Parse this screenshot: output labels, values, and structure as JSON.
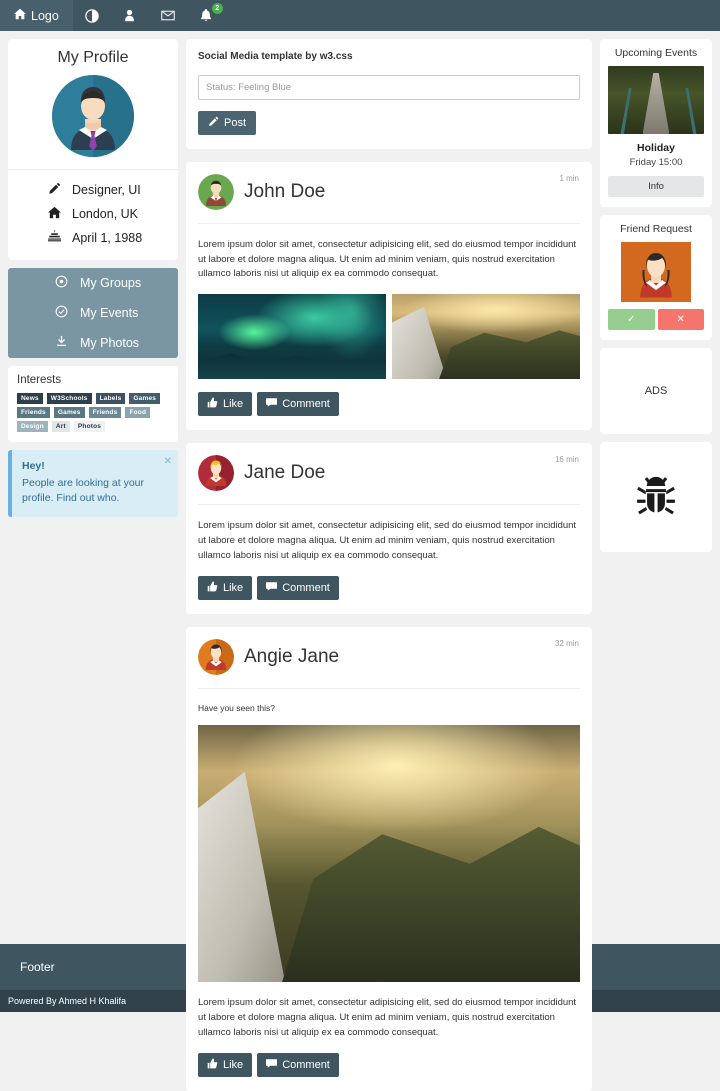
{
  "topbar": {
    "logo_label": "Logo",
    "logo_icon": "home-icon",
    "icons": [
      {
        "name": "globe-icon",
        "glyph": "◔"
      },
      {
        "name": "user-icon",
        "glyph": "♟"
      },
      {
        "name": "envelope-icon",
        "glyph": "✉"
      },
      {
        "name": "bell-icon",
        "glyph": "ὑ4",
        "badge": "2"
      }
    ],
    "badge_count": "2",
    "bg_color": "#3f5661",
    "badge_color": "#4CAF50"
  },
  "profile": {
    "title": "My Profile",
    "avatar": "male-avatar",
    "meta": [
      {
        "icon": "pencil-icon",
        "label": "Designer, UI"
      },
      {
        "icon": "home-icon",
        "label": "London, UK"
      },
      {
        "icon": "birthday-cake-icon",
        "label": "April 1, 1988"
      }
    ]
  },
  "menu": {
    "bg_color": "#7b96a3",
    "items": [
      {
        "icon": "bullseye-icon",
        "label": "My Groups"
      },
      {
        "icon": "check-circle-icon",
        "label": "My Events"
      },
      {
        "icon": "download-icon",
        "label": "My Photos"
      }
    ]
  },
  "interests": {
    "title": "Interests",
    "tags": [
      {
        "label": "News",
        "shade": "#2e3f4a"
      },
      {
        "label": "W3Schools",
        "shade": "#2e3f4a"
      },
      {
        "label": "Labels",
        "shade": "#3c5260"
      },
      {
        "label": "Games",
        "shade": "#445d6b"
      },
      {
        "label": "Friends",
        "shade": "#5a7784"
      },
      {
        "label": "Games",
        "shade": "#5a7784"
      },
      {
        "label": "Friends",
        "shade": "#6c8896"
      },
      {
        "label": "Food",
        "shade": "#8aa3af"
      },
      {
        "label": "Design",
        "shade": "#9db3bd"
      },
      {
        "label": "Art",
        "shade": "#dfe6ea",
        "text": "#333"
      },
      {
        "label": "Photos",
        "shade": "#eef2f4",
        "text": "#333"
      }
    ]
  },
  "alert": {
    "title": "Hey!",
    "text": "People are looking at your profile. Find out who.",
    "close_icon": "close-icon",
    "bg_color": "#d9edf7"
  },
  "composer": {
    "heading": "Social Media template by w3.css",
    "placeholder": "Status: Feeling Blue",
    "value": "",
    "post_label": "Post",
    "post_icon": "pencil-icon"
  },
  "posts": [
    {
      "author": "John Doe",
      "time": "1 min",
      "avatar": "male-avatar-green",
      "text": "Lorem ipsum dolor sit amet, consectetur adipisicing elit, sed do eiusmod tempor incididunt ut labore et dolore magna aliqua. Ut enim ad minim veniam, quis nostrud exercitation ullamco laboris nisi ut aliquip ex ea commodo consequat.",
      "caption": "",
      "images": [
        "aurora-photo",
        "mountain-photo"
      ],
      "like_label": "Like",
      "comment_label": "Comment"
    },
    {
      "author": "Jane Doe",
      "time": "16 min",
      "avatar": "female-avatar-red",
      "text": "Lorem ipsum dolor sit amet, consectetur adipisicing elit, sed do eiusmod tempor incididunt ut labore et dolore magna aliqua. Ut enim ad minim veniam, quis nostrud exercitation ullamco laboris nisi ut aliquip ex ea commodo consequat.",
      "caption": "",
      "images": [],
      "like_label": "Like",
      "comment_label": "Comment"
    },
    {
      "author": "Angie Jane",
      "time": "32 min",
      "avatar": "female-avatar-orange",
      "caption": "Have you seen this?",
      "text": "Lorem ipsum dolor sit amet, consectetur adipisicing elit, sed do eiusmod tempor incididunt ut labore et dolore magna aliqua. Ut enim ad minim veniam, quis nostrud exercitation ullamco laboris nisi ut aliquip ex ea commodo consequat.",
      "images": [
        "mountain-photo-large"
      ],
      "like_label": "Like",
      "comment_label": "Comment"
    }
  ],
  "events": {
    "title": "Upcoming Events",
    "image": "forest-bridge-photo",
    "name": "Holiday",
    "time": "Friday 15:00",
    "info_label": "Info"
  },
  "friend_request": {
    "title": "Friend Request",
    "image": "female-avatar-orange-bg",
    "accept_icon": "check-icon",
    "reject_icon": "close-icon",
    "accept_color": "#96ce8f",
    "reject_color": "#f4756b"
  },
  "ads": {
    "label": "ADS"
  },
  "bug": {
    "icon": "bug-icon"
  },
  "footer": {
    "label": "Footer",
    "credit": "Powered By Ahmed H Khalifa",
    "bg_color": "#3f5661",
    "credit_bg": "#32424b"
  }
}
